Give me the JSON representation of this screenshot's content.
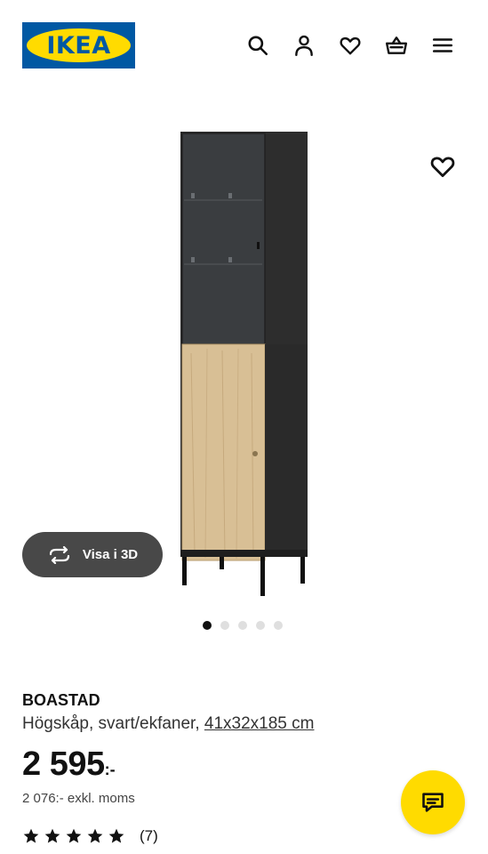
{
  "brand": {
    "logo_text": "IKEA",
    "blue": "#0058a3",
    "yellow": "#ffdb00"
  },
  "header": {
    "icons": [
      "search-icon",
      "user-icon",
      "heart-icon",
      "basket-icon",
      "menu-icon"
    ]
  },
  "gallery": {
    "view3d_label": "Visa i 3D",
    "dot_count": 5,
    "active_dot": 1
  },
  "product": {
    "name": "BOASTAD",
    "description": "Högskåp, svart/ekfaner,",
    "dimensions": "41x32x185 cm",
    "price_main": "2 595",
    "price_suffix": ":-",
    "price_excl_vat": "2 076:- exkl. moms",
    "rating_stars": 5,
    "rating_count": "(7)"
  },
  "chat": {
    "icon": "chat-icon"
  }
}
